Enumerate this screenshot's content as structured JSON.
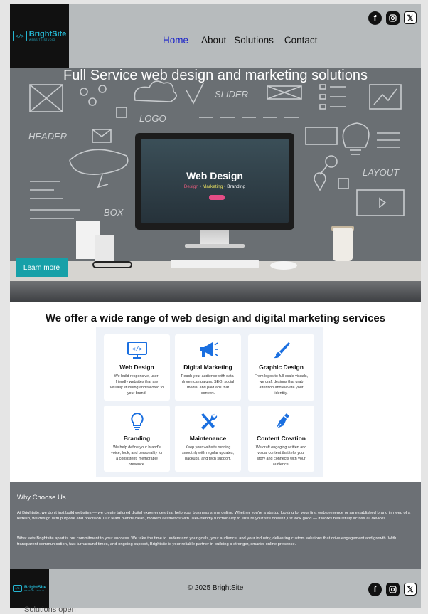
{
  "header": {
    "logo_name": "BrightSite",
    "logo_sub": "WEBSITE STUDIO",
    "nav": [
      "Home",
      "About",
      "Solutions",
      "Contact"
    ],
    "social_icons": [
      "facebook-icon",
      "instagram-icon",
      "x-icon"
    ]
  },
  "hero": {
    "title": "Full Service web design and marketing solutions",
    "screen_title": "Web Design",
    "screen_sub_design": "Design",
    "screen_sub_marketing": "Marketing",
    "screen_sub_branding": "Branding",
    "learn_more": "Learn more",
    "chalk_words": [
      "SLIDER",
      "LOGO",
      "HEADER",
      "BOX",
      "LAYOUT"
    ]
  },
  "services": {
    "title": "We offer a wide range of web design and digital marketing services",
    "cards": [
      {
        "title": "Web Design",
        "text": "We build responsive, user-friendly websites that are visually stunning and tailored to your brand."
      },
      {
        "title": "Digital Marketing",
        "text": "Reach your audience with data-driven campaigns, SEO, social media, and paid ads that convert."
      },
      {
        "title": "Graphic Design",
        "text": "From logos to full-scale visuals, we craft designs that grab attention and elevate your identity."
      },
      {
        "title": "Branding",
        "text": "We help define your brand's voice, look, and personality for a consistent, memorable presence."
      },
      {
        "title": "Maintenance",
        "text": "Keep your website running smoothly with regular updates, backups, and tech support."
      },
      {
        "title": "Content Creation",
        "text": "We craft engaging written and visual content that tells your story and connects with your audience."
      }
    ]
  },
  "why": {
    "title": "Why Choose Us",
    "p1": "At Brightsite, we don't just build websites — we create tailored digital experiences that help your business shine online. Whether you're a startup looking for your first web presence or an established brand in need of a refresh, we design with purpose and precision. Our team blends clean, modern aesthetics with user-friendly functionality to ensure your site doesn't just look good — it works beautifully across all devices.",
    "p2": "What sets Brightsite apart is our commitment to your success. We take the time to understand your goals, your audience, and your industry, delivering custom solutions that drive engagement and growth. With transparent communication, fast turnaround times, and ongoing support, Brightsite is your reliable partner in building a stronger, smarter online presence."
  },
  "footer": {
    "copyright": "© 2025 BrightSite"
  },
  "status": "Solutions open",
  "colors": {
    "accent": "#17a0a8",
    "nav_active": "#1a22c9",
    "logo": "#25b6d2",
    "icon_blue": "#1a6fe0"
  }
}
